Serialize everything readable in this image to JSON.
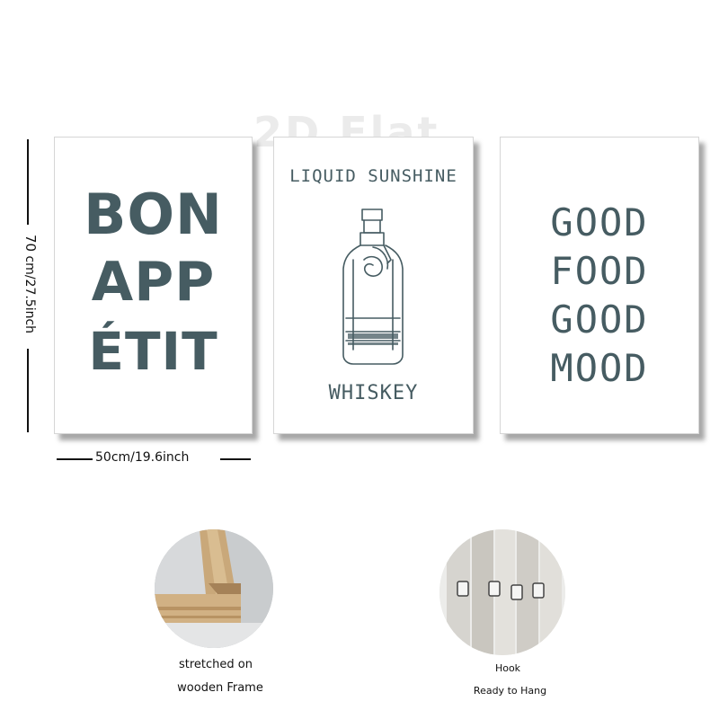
{
  "watermark": "2D Flat",
  "panels": {
    "left": {
      "line1": "BON",
      "line2": "APP",
      "line3": "ÉTIT"
    },
    "middle": {
      "top_text": "LIQUID SUNSHINE",
      "bottom_text": "WHISKEY"
    },
    "right": {
      "line1": "GOOD",
      "line2": "FOOD",
      "line3": "GOOD",
      "line4": "MOOD"
    }
  },
  "dimensions": {
    "height_big": "70",
    "height_rest": " cm/27.5inch",
    "width": "50cm/19.6inch"
  },
  "captions": {
    "frame_line1": "stretched on",
    "frame_line2": "wooden Frame",
    "hook_line1": "Hook",
    "hook_line2": "Ready to Hang"
  },
  "colors": {
    "print_ink": "#465c62",
    "background": "#ffffff"
  }
}
